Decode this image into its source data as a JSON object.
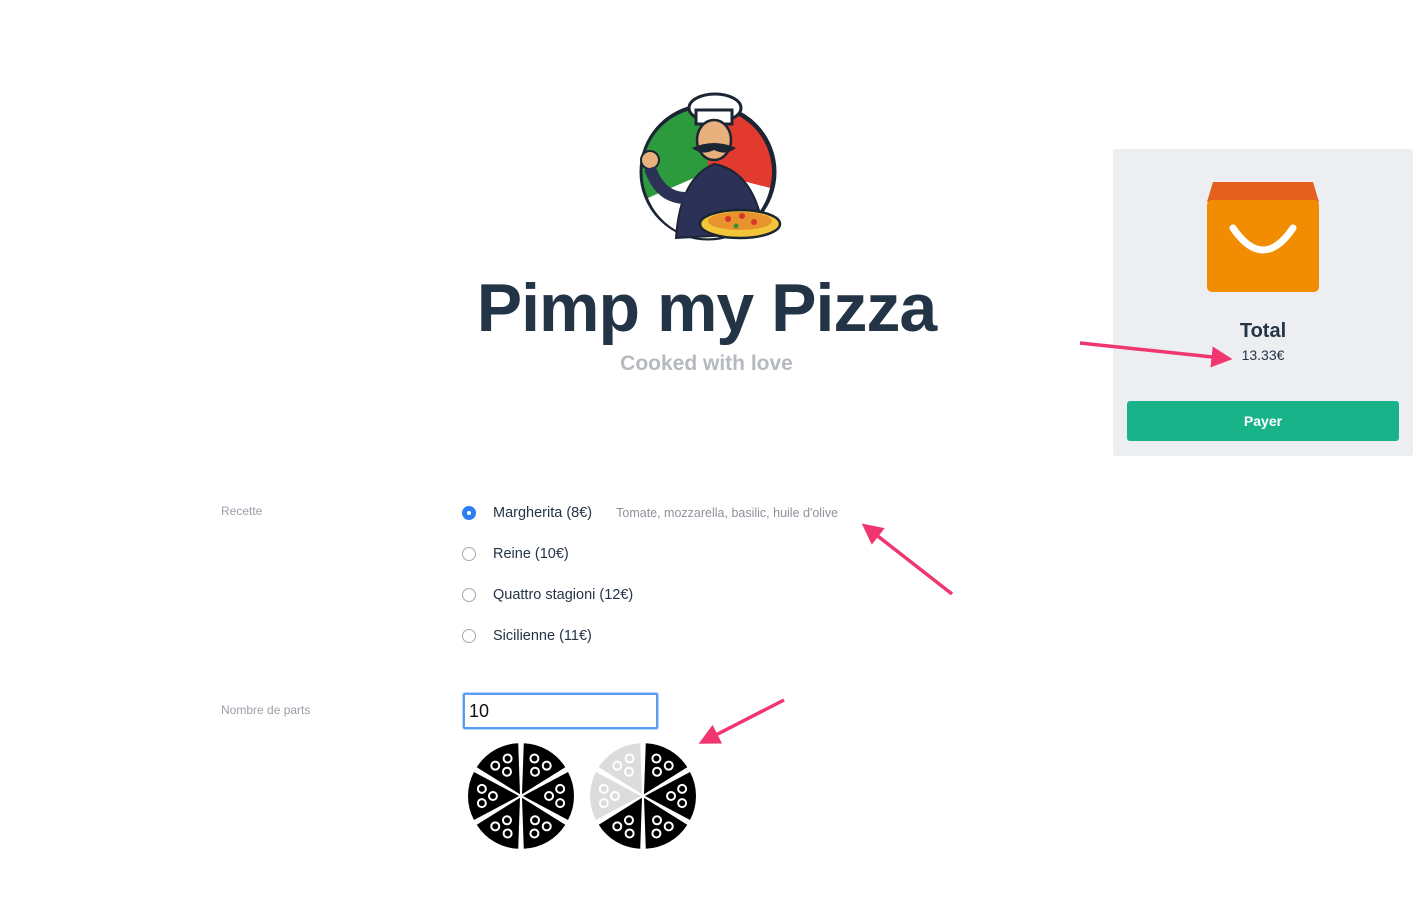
{
  "header": {
    "logo_icon": "chef-pizza-logo-icon",
    "title": "Pimp my Pizza",
    "subtitle": "Cooked with love"
  },
  "cart": {
    "icon": "shopping-bag-icon",
    "total_label": "Total",
    "total_value": "13.33€",
    "pay_label": "Payer"
  },
  "form": {
    "recipe_label": "Recette",
    "recipes": [
      {
        "label": "Margherita (8€)",
        "description": "Tomate, mozzarella, basilic, huile d'olive",
        "selected": true
      },
      {
        "label": "Reine (10€)",
        "description": "",
        "selected": false
      },
      {
        "label": "Quattro stagioni (12€)",
        "description": "",
        "selected": false
      },
      {
        "label": "Sicilienne (11€)",
        "description": "",
        "selected": false
      }
    ],
    "parts_label": "Nombre de parts",
    "parts_value": "10",
    "pizza_icon": "pizza-slices-icon",
    "pizza_fill": [
      1,
      0.666
    ]
  },
  "colors": {
    "title": "#243447",
    "subtitle": "#b5b9c0",
    "accent_pay": "#19b38a",
    "bag": "#f28c00",
    "radio_selected": "#2c7ef4",
    "annotation_arrow": "#f0366e"
  }
}
